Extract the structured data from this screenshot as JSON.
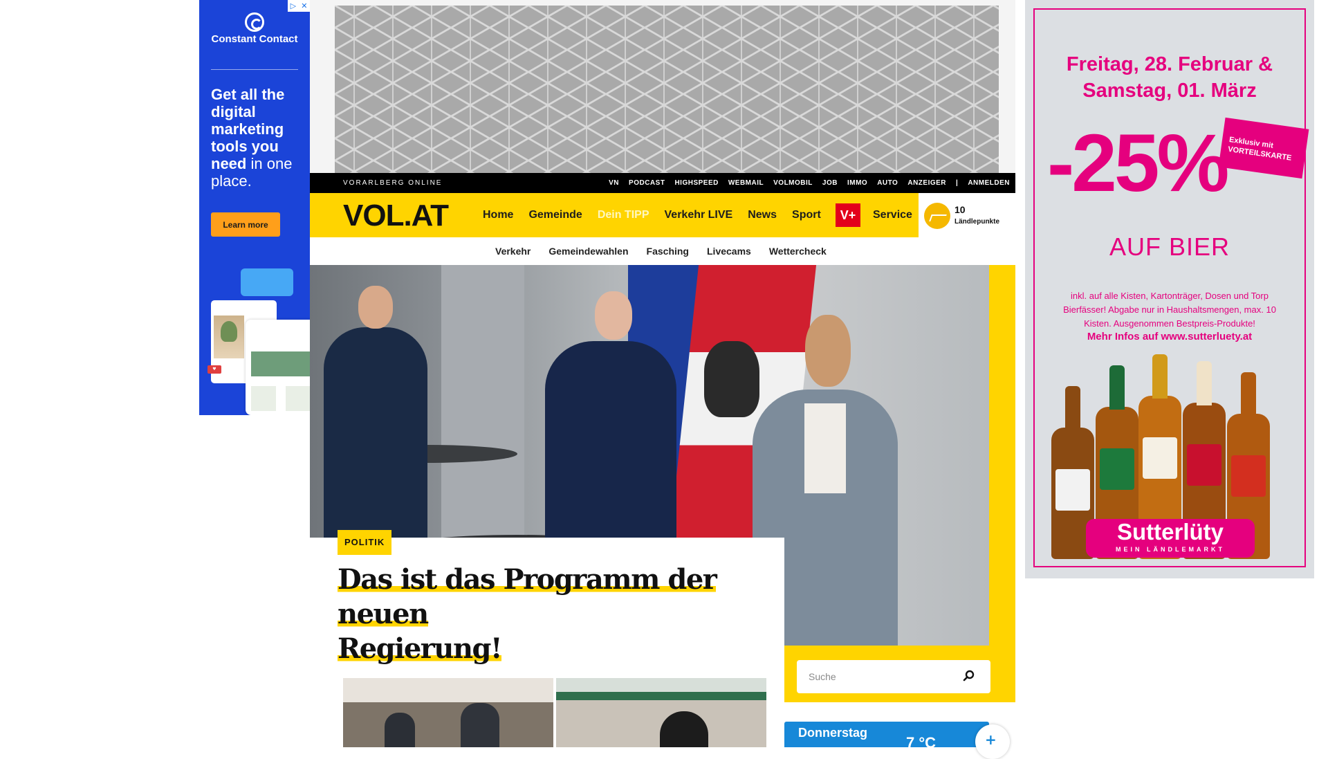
{
  "left_ad": {
    "brand": "Constant Contact",
    "headline_bold": "Get all the digital marketing tools you need",
    "headline_light": "in one place.",
    "cta": "Learn more",
    "adchoices_icon": "adchoices-icon",
    "close_icon": "close-icon",
    "brand_color": "#1b44d8",
    "cta_color": "#ff9f1a"
  },
  "topbar": {
    "brand": "VORARLBERG ONLINE",
    "links": [
      "VN",
      "PODCAST",
      "HIGHSPEED",
      "WEBMAIL",
      "VOLMOBIL",
      "JOB",
      "IMMO",
      "AUTO",
      "ANZEIGER",
      "|",
      "ANMELDEN"
    ]
  },
  "mainnav": {
    "logo": "VOL.AT",
    "items": [
      "Home",
      "Gemeinde",
      "Dein TIPP",
      "Verkehr LIVE",
      "News",
      "Sport"
    ],
    "vplus": "V+",
    "service": "Service",
    "points_value": "10",
    "points_label": "Ländlepunkte",
    "accent_color": "#ffd400"
  },
  "subnav": {
    "items": [
      "Verkehr",
      "Gemeindewahlen",
      "Fasching",
      "Livecams",
      "Wettercheck"
    ]
  },
  "hero": {
    "category": "POLITIK",
    "headline_line1": "Das ist das Programm der neuen",
    "headline_line2": "Regierung!"
  },
  "search": {
    "placeholder": "Suche",
    "icon": "search-icon"
  },
  "weather": {
    "day": "Donnerstag",
    "temp": "7 °C"
  },
  "right_ad": {
    "date": "Freitag, 28. Februar & Samstag, 01. März",
    "discount": "-25%",
    "badge_line1": "Exklusiv mit",
    "badge_line2": "VORTEILSKARTE",
    "product": "AUF BIER",
    "fine_print": "inkl. auf alle Kisten, Kartonträger, Dosen und Torp Bierfässer! Abgabe nur in Haushaltsmengen, max. 10 Kisten. Ausgenommen Bestpreis-Produkte!",
    "more_info": "Mehr Infos auf www.sutterluety.at",
    "brand": "Sutterlüty",
    "brand_tagline": "MEIN LÄNDLEMARKT",
    "brand_color": "#e5007e"
  }
}
